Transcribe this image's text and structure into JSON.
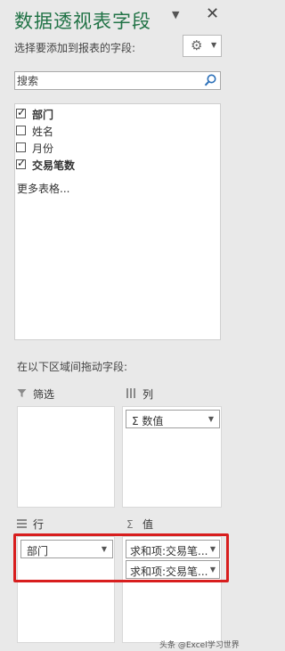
{
  "panel": {
    "title": "数据透视表字段",
    "choose_label": "选择要添加到报表的字段:",
    "dropdown_icon": "caret-down-icon",
    "close_icon": "close-icon",
    "gear_icon": "gear-icon"
  },
  "search": {
    "placeholder": "搜索",
    "icon": "search-icon"
  },
  "fields": [
    {
      "label": "部门",
      "checked": true,
      "bold": true
    },
    {
      "label": "姓名",
      "checked": false,
      "bold": false
    },
    {
      "label": "月份",
      "checked": false,
      "bold": false
    },
    {
      "label": "交易笔数",
      "checked": true,
      "bold": true
    }
  ],
  "more_tables": "更多表格...",
  "drag_label": "在以下区域间拖动字段:",
  "areas": {
    "filter": {
      "label": "筛选",
      "icon": "filter-icon"
    },
    "columns": {
      "label": "列",
      "icon": "columns-icon",
      "pills": [
        "数值"
      ]
    },
    "rows": {
      "label": "行",
      "icon": "rows-icon",
      "pills": [
        "部门"
      ]
    },
    "values": {
      "label": "值",
      "icon": "sigma-icon",
      "pills": [
        "求和项:交易笔...",
        "求和项:交易笔..."
      ]
    }
  },
  "watermark": "头条 @Excel学习世界",
  "colors": {
    "title": "#217346",
    "highlight": "#d81e1e"
  }
}
